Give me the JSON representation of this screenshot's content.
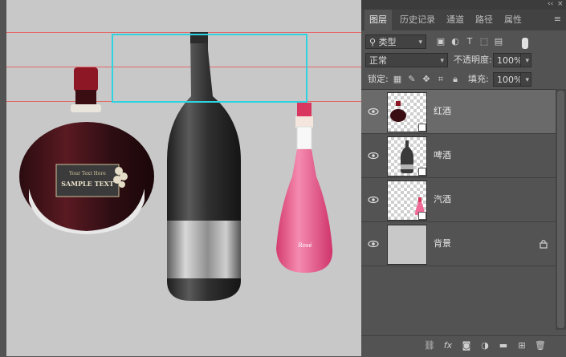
{
  "panel": {
    "tabs": [
      "图层",
      "历史记录",
      "通道",
      "路径",
      "属性"
    ],
    "active_tab": 0,
    "filter": {
      "label": "类型"
    },
    "blend_mode": "正常",
    "opacity_label": "不透明度:",
    "opacity_value": "100%",
    "lock_label": "锁定:",
    "fill_label": "填充:",
    "fill_value": "100%",
    "layers": [
      {
        "name": "红酒",
        "selected": true
      },
      {
        "name": "啤酒",
        "selected": false
      },
      {
        "name": "汽酒",
        "selected": false
      },
      {
        "name": "背景",
        "selected": false,
        "locked": true
      }
    ]
  },
  "canvas": {
    "bottle_label_script": "Your Text Here",
    "bottle_label_text": "SAMPLE TEXT",
    "pink_label_script": "Rosé",
    "colors": {
      "canvas_bg": "#c8c8c8",
      "guide": "#e26a6a",
      "selection": "#2fd3df"
    }
  },
  "icons": {
    "filter": "search-icon",
    "eye": "eye-icon",
    "lock": "lock-icon",
    "link": "link-layers-icon",
    "fx": "fx-icon",
    "mask": "add-mask-icon",
    "adjust": "adjustment-layer-icon",
    "group": "new-group-icon",
    "new": "new-layer-icon",
    "delete": "trash-icon"
  }
}
